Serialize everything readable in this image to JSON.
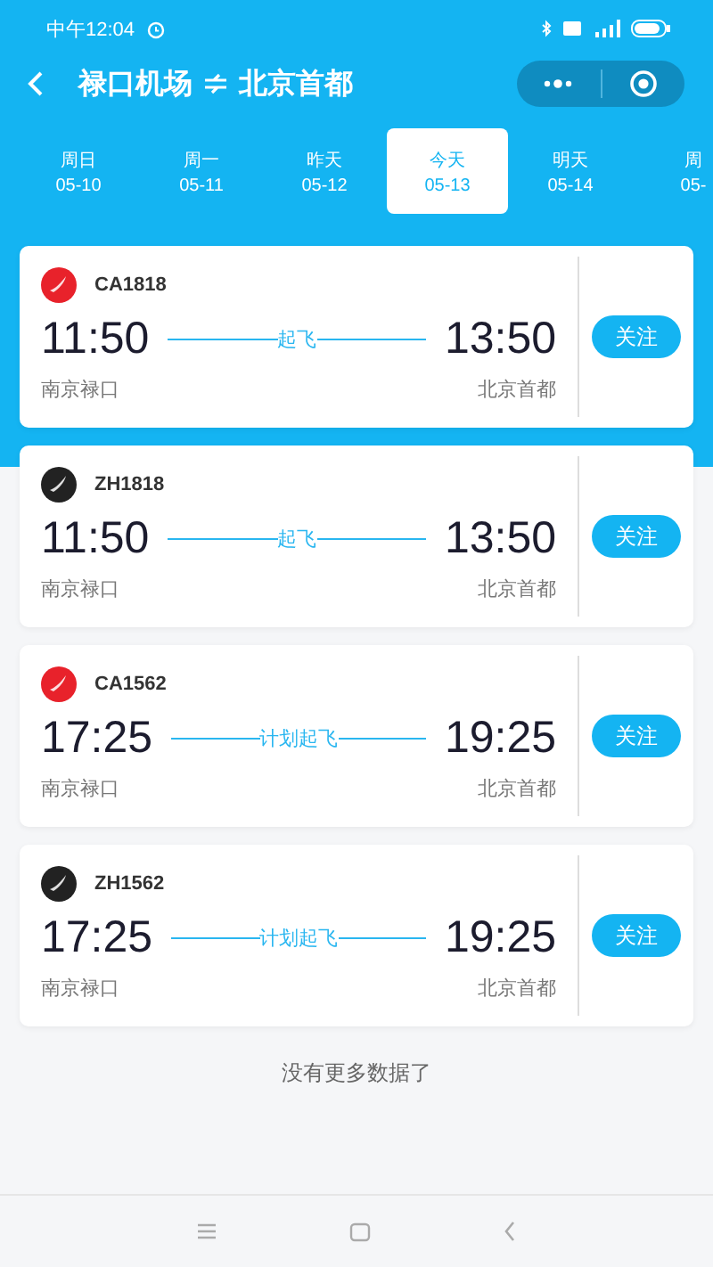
{
  "status_bar": {
    "time": "中午12:04"
  },
  "header": {
    "from": "禄口机场",
    "to": "北京首都"
  },
  "date_tabs": [
    {
      "day": "周日",
      "date": "05-10",
      "selected": false
    },
    {
      "day": "周一",
      "date": "05-11",
      "selected": false
    },
    {
      "day": "昨天",
      "date": "05-12",
      "selected": false
    },
    {
      "day": "今天",
      "date": "05-13",
      "selected": true
    },
    {
      "day": "明天",
      "date": "05-14",
      "selected": false
    },
    {
      "day": "周",
      "date": "05-",
      "selected": false
    }
  ],
  "flights": [
    {
      "number": "CA1818",
      "color": "#e8222b",
      "depart": "11:50",
      "status": "起飞",
      "arrive": "13:50",
      "from": "南京禄口",
      "to": "北京首都",
      "follow": "关注"
    },
    {
      "number": "ZH1818",
      "color": "#222222",
      "depart": "11:50",
      "status": "起飞",
      "arrive": "13:50",
      "from": "南京禄口",
      "to": "北京首都",
      "follow": "关注"
    },
    {
      "number": "CA1562",
      "color": "#e8222b",
      "depart": "17:25",
      "status": "计划起飞",
      "arrive": "19:25",
      "from": "南京禄口",
      "to": "北京首都",
      "follow": "关注"
    },
    {
      "number": "ZH1562",
      "color": "#222222",
      "depart": "17:25",
      "status": "计划起飞",
      "arrive": "19:25",
      "from": "南京禄口",
      "to": "北京首都",
      "follow": "关注"
    }
  ],
  "footer_note": "没有更多数据了"
}
